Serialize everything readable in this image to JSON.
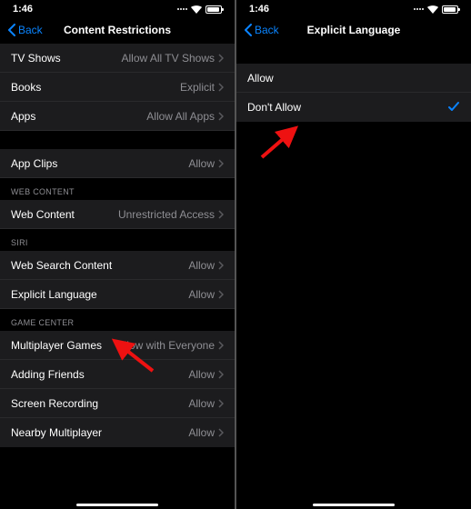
{
  "left": {
    "status": {
      "time": "1:46"
    },
    "nav": {
      "back": "Back",
      "title": "Content Restrictions"
    },
    "rows": {
      "tv_shows": {
        "label": "TV Shows",
        "value": "Allow All TV Shows"
      },
      "books": {
        "label": "Books",
        "value": "Explicit"
      },
      "apps": {
        "label": "Apps",
        "value": "Allow All Apps"
      },
      "app_clips": {
        "label": "App Clips",
        "value": "Allow"
      }
    },
    "sections": {
      "web_content": "WEB CONTENT",
      "siri": "SIRI",
      "game_center": "GAME CENTER"
    },
    "web": {
      "web_content": {
        "label": "Web Content",
        "value": "Unrestricted Access"
      }
    },
    "siri": {
      "web_search": {
        "label": "Web Search Content",
        "value": "Allow"
      },
      "explicit_lang": {
        "label": "Explicit Language",
        "value": "Allow"
      }
    },
    "game": {
      "multiplayer": {
        "label": "Multiplayer Games",
        "value": "Allow with Everyone"
      },
      "adding_friends": {
        "label": "Adding Friends",
        "value": "Allow"
      },
      "screen_rec": {
        "label": "Screen Recording",
        "value": "Allow"
      },
      "nearby": {
        "label": "Nearby Multiplayer",
        "value": "Allow"
      }
    }
  },
  "right": {
    "status": {
      "time": "1:46"
    },
    "nav": {
      "back": "Back",
      "title": "Explicit Language"
    },
    "options": {
      "allow": "Allow",
      "dont_allow": "Don't Allow"
    }
  }
}
